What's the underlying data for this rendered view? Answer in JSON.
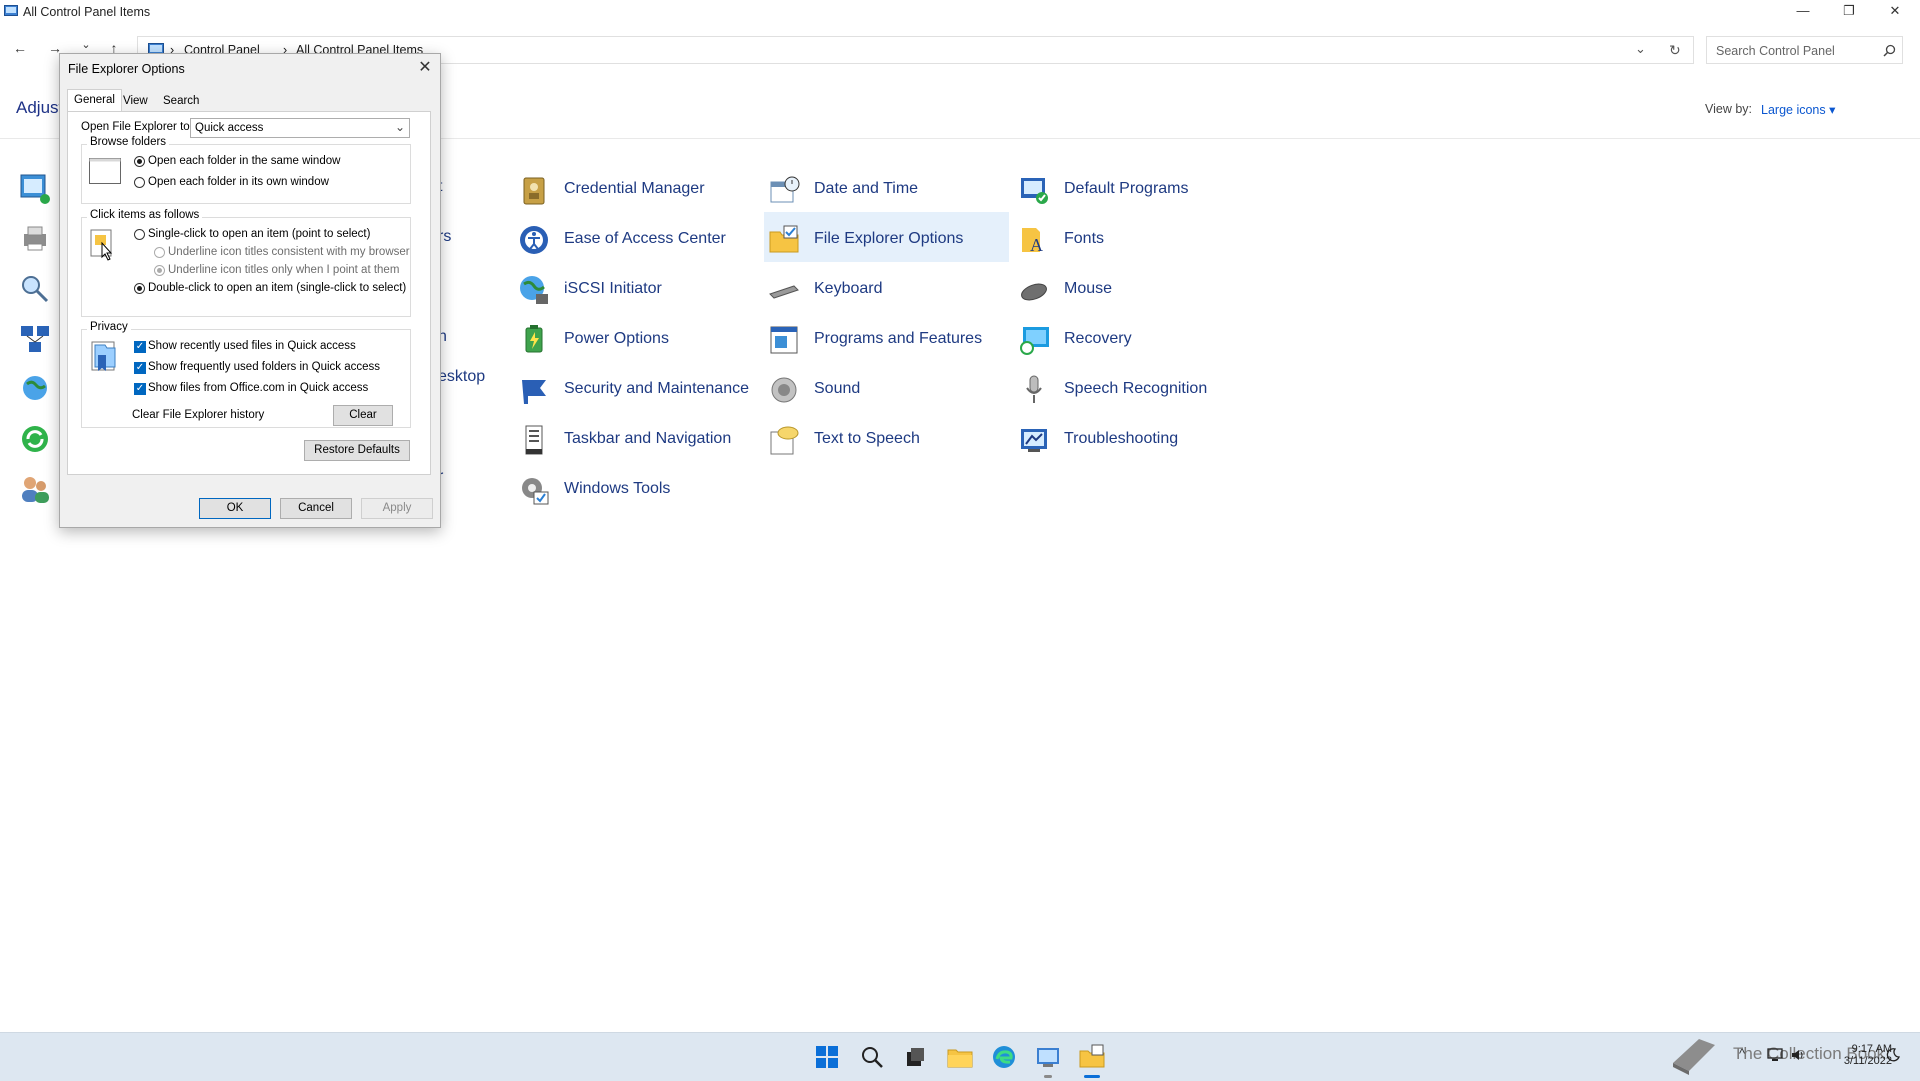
{
  "window": {
    "title": "All Control Panel Items",
    "minimize": "—",
    "maximize": "❐",
    "close": "✕"
  },
  "nav": {
    "back": "←",
    "forward": "→",
    "recent": "⌄",
    "up": "↑",
    "breadcrumb": [
      "Control Panel",
      "All Control Panel Items"
    ],
    "search_placeholder": "Search Control Panel"
  },
  "header": {
    "heading_partial": "Adjust",
    "view_by_label": "View by:",
    "view_by_value": "Large icons"
  },
  "items": {
    "col2": [
      "Credential Manager",
      "Ease of Access Center",
      "iSCSI Initiator",
      "Power Options",
      "Security and Maintenance",
      "Taskbar and Navigation",
      "Windows Tools"
    ],
    "col3": [
      "Date and Time",
      "File Explorer Options",
      "Keyboard",
      "Programs and Features",
      "Sound",
      "Text to Speech"
    ],
    "col4": [
      "Default Programs",
      "Fonts",
      "Mouse",
      "Recovery",
      "Speech Recognition",
      "Troubleshooting"
    ],
    "col1_partial": [
      "t",
      "rs",
      "n",
      "esktop",
      "r"
    ]
  },
  "dialog": {
    "title": "File Explorer Options",
    "tabs": [
      "General",
      "View",
      "Search"
    ],
    "open_to_label": "Open File Explorer to:",
    "open_to_value": "Quick access",
    "browse_group": "Browse folders",
    "browse_same": "Open each folder in the same window",
    "browse_own": "Open each folder in its own window",
    "click_group": "Click items as follows",
    "single_click": "Single-click to open an item (point to select)",
    "underline_browser": "Underline icon titles consistent with my browser",
    "underline_point": "Underline icon titles only when I point at them",
    "double_click": "Double-click to open an item (single-click to select)",
    "privacy_group": "Privacy",
    "privacy_recent_files": "Show recently used files in Quick access",
    "privacy_frequent_folders": "Show frequently used folders in Quick access",
    "privacy_office": "Show files from Office.com in Quick access",
    "clear_history_label": "Clear File Explorer history",
    "clear_button": "Clear",
    "restore_defaults": "Restore Defaults",
    "ok": "OK",
    "cancel": "Cancel",
    "apply": "Apply"
  },
  "taskbar": {
    "time": "9:17 AM",
    "date": "3/11/2022",
    "tray_chevron": "^"
  },
  "watermark": "The Collection Book"
}
